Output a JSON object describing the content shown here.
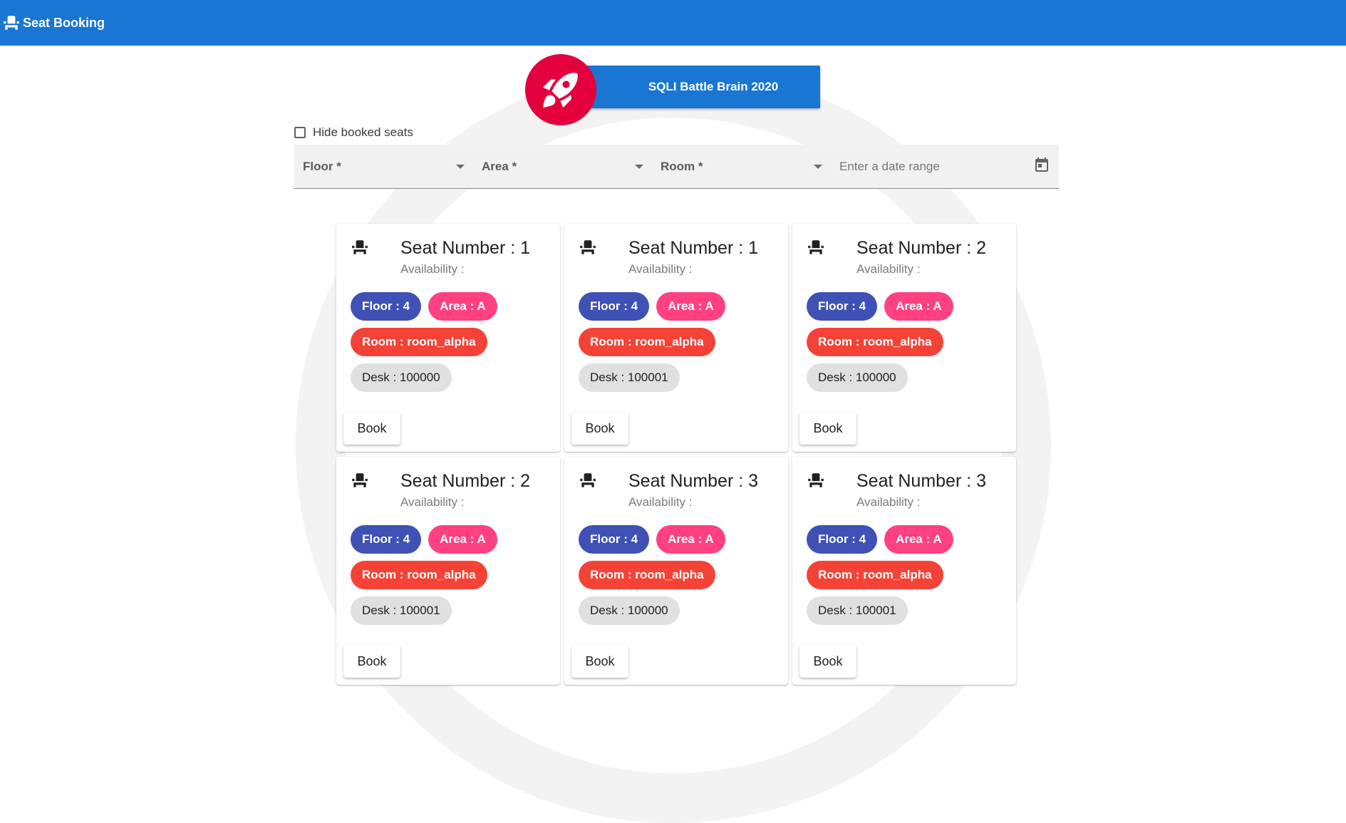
{
  "app": {
    "title": "Seat Booking",
    "icon": "seat-icon"
  },
  "event": {
    "label": "SQLI Battle Brain 2020",
    "icon": "rocket-icon",
    "accent": "#e3003c"
  },
  "filters": {
    "hide_booked_label": "Hide booked seats",
    "hide_booked_checked": false,
    "floor_label": "Floor *",
    "area_label": "Area *",
    "room_label": "Room *",
    "date_placeholder": "Enter a date range"
  },
  "colors": {
    "primary": "#1976d2",
    "floor_chip": "#3f51b5",
    "area_chip": "#ff4081",
    "room_chip": "#f44336",
    "desk_chip": "#e0e0e0"
  },
  "seats": [
    {
      "title": "Seat Number : 1",
      "availability": "Availability :",
      "floor": "Floor : 4",
      "area": "Area : A",
      "room": "Room : room_alpha",
      "desk": "Desk : 100000",
      "action": "Book"
    },
    {
      "title": "Seat Number : 1",
      "availability": "Availability :",
      "floor": "Floor : 4",
      "area": "Area : A",
      "room": "Room : room_alpha",
      "desk": "Desk : 100001",
      "action": "Book"
    },
    {
      "title": "Seat Number : 2",
      "availability": "Availability :",
      "floor": "Floor : 4",
      "area": "Area : A",
      "room": "Room : room_alpha",
      "desk": "Desk : 100000",
      "action": "Book"
    },
    {
      "title": "Seat Number : 2",
      "availability": "Availability :",
      "floor": "Floor : 4",
      "area": "Area : A",
      "room": "Room : room_alpha",
      "desk": "Desk : 100001",
      "action": "Book"
    },
    {
      "title": "Seat Number : 3",
      "availability": "Availability :",
      "floor": "Floor : 4",
      "area": "Area : A",
      "room": "Room : room_alpha",
      "desk": "Desk : 100000",
      "action": "Book"
    },
    {
      "title": "Seat Number : 3",
      "availability": "Availability :",
      "floor": "Floor : 4",
      "area": "Area : A",
      "room": "Room : room_alpha",
      "desk": "Desk : 100001",
      "action": "Book"
    }
  ]
}
